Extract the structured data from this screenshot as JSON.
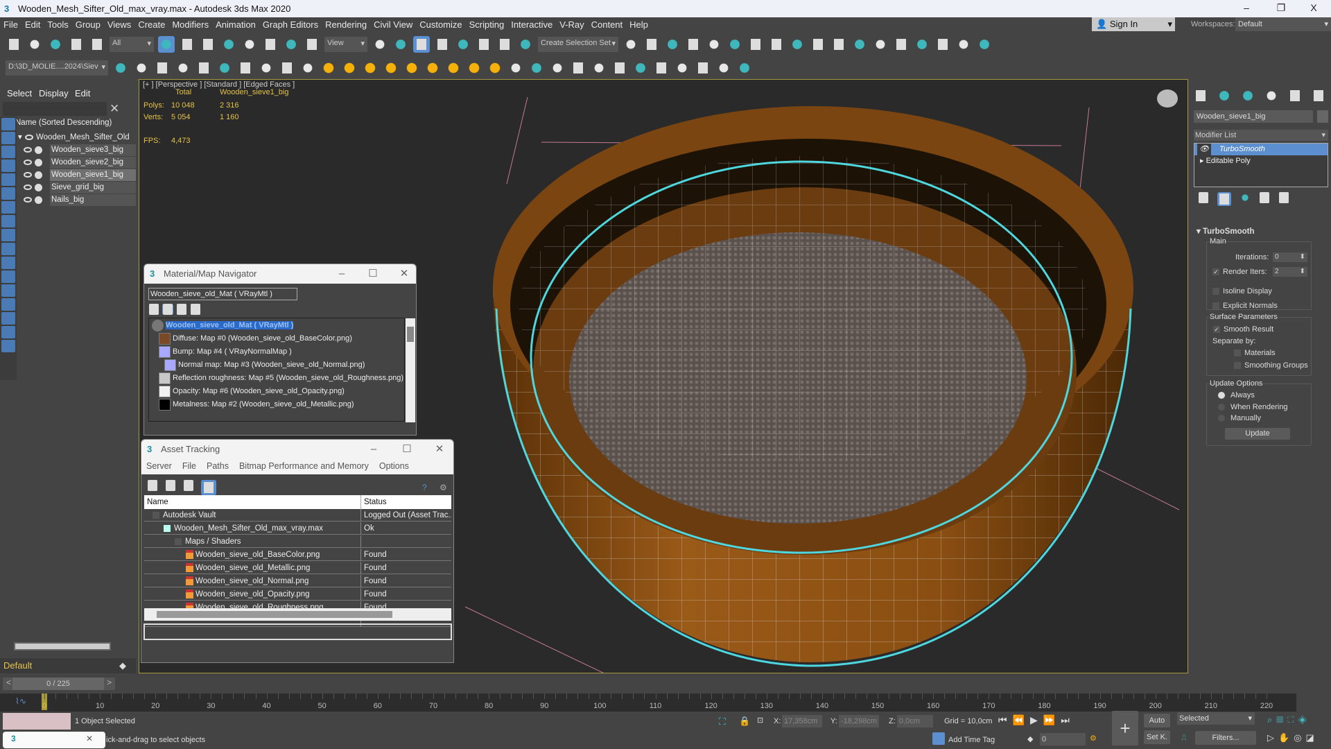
{
  "window": {
    "title": "Wooden_Mesh_Sifter_Old_max_vray.max - Autodesk 3ds Max 2020",
    "minimize": "–",
    "restore": "❐",
    "close": "X"
  },
  "menu": [
    "File",
    "Edit",
    "Tools",
    "Group",
    "Views",
    "Create",
    "Modifiers",
    "Animation",
    "Graph Editors",
    "Rendering",
    "Civil View",
    "Customize",
    "Scripting",
    "Interactive",
    "V-Ray",
    "Content",
    "Help"
  ],
  "account": {
    "sign_in": "Sign In",
    "workspaces_label": "Workspaces:",
    "workspace": "Default"
  },
  "toolbar1": {
    "filter": "All",
    "ref_coord": "View",
    "selection_set": "Create Selection Set",
    "icons": [
      "undo-icon",
      "redo-icon",
      "link-icon",
      "unlink-icon",
      "bind-spacewarp-icon",
      "select-object-icon",
      "select-by-name-icon",
      "rect-selection-icon",
      "window-crossing-icon",
      "move-icon",
      "rotate-icon",
      "scale-icon",
      "placement-icon",
      "pivot-icon",
      "keyboard-shortcut-icon",
      "select-manipulate-icon",
      "snap-3d-icon",
      "angle-snap-icon",
      "percent-snap-icon",
      "spinner-snap-icon",
      "edit-named-sets-icon",
      "mirror-icon",
      "align-icon",
      "scene-explorer-icon",
      "layer-explorer-icon",
      "toggle-ribbon-icon",
      "curve-editor-icon",
      "dope-sheet-icon",
      "schematic-view-icon",
      "material-editor-icon",
      "render-setup-icon",
      "rendered-frame-icon",
      "render-icon",
      "render-iterative-icon",
      "render-online-icon",
      "vray-icon",
      "a360-icon",
      "render-in-cloud-icon",
      "render-queue-icon"
    ]
  },
  "toolbar2": {
    "project_path": "D:\\3D_MOLIE....2024\\Siev",
    "icons": [
      "project-settings-icon",
      "open-project-icon",
      "new-project-icon",
      "project-folder-icon",
      "teapot-icon",
      "sphere-object-icon",
      "box-object-icon",
      "vray-light-icon",
      "vray-camera-icon",
      "physical-camera-icon",
      "dome-light-icon",
      "sphere-light-icon",
      "sun-icon",
      "mesh-light-icon",
      "ies-light-icon",
      "spot-light-icon",
      "sun-sky-icon",
      "ambient-light-icon",
      "proxy-icon",
      "vray-fur-icon",
      "vray-plane-icon",
      "fire-icon",
      "vray-mtl-icon",
      "multi-material-icon",
      "material-palette-icon",
      "material-convert-icon",
      "frame-buffer-icon",
      "vray-logo-icon",
      "forest-icon",
      "log-icon",
      "help-icon"
    ]
  },
  "explorer": {
    "menu": [
      "Select",
      "Display",
      "Edit"
    ],
    "column": "Name (Sorted Descending)",
    "items": [
      {
        "name": "Wooden_Mesh_Sifter_Old",
        "level": 0
      },
      {
        "name": "Wooden_sieve3_big",
        "level": 1
      },
      {
        "name": "Wooden_sieve2_big",
        "level": 1
      },
      {
        "name": "Wooden_sieve1_big",
        "level": 1,
        "selected": true
      },
      {
        "name": "Sieve_grid_big",
        "level": 1
      },
      {
        "name": "Nails_big",
        "level": 1
      }
    ],
    "layer": "Default"
  },
  "viewport": {
    "label": "[+ ] [Perspective ] [Standard ] [Edged Faces ]",
    "stats": {
      "col_total": "Total",
      "col_sel": "Wooden_sieve1_big",
      "polys_label": "Polys:",
      "polys_total": "10 048",
      "polys_sel": "2 316",
      "verts_label": "Verts:",
      "verts_total": "5 054",
      "verts_sel": "1 160",
      "fps_label": "FPS:",
      "fps": "4,473"
    },
    "colors": {
      "wood": "#8a4e12",
      "selection": "#4fd7e0",
      "border": "#a89a3c"
    }
  },
  "material_navigator": {
    "title": "Material/Map Navigator",
    "field": "Wooden_sieve_old_Mat  ( VRayMtl )",
    "root": "Wooden_sieve_old_Mat  ( VRayMtl )",
    "maps": [
      {
        "label": "Diffuse: Map #0 (Wooden_sieve_old_BaseColor.png)",
        "swatch": "#7a4a26",
        "indent": 0
      },
      {
        "label": "Bump: Map #4  ( VRayNormalMap )",
        "swatch": "#a9a8ff",
        "indent": 0
      },
      {
        "label": "Normal map: Map #3 (Wooden_sieve_old_Normal.png)",
        "swatch": "#a9a8ff",
        "indent": 1
      },
      {
        "label": "Reflection roughness: Map #5 (Wooden_sieve_old_Roughness.png)",
        "swatch": "#c8c8c8",
        "indent": 0
      },
      {
        "label": "Opacity: Map #6 (Wooden_sieve_old_Opacity.png)",
        "swatch": "#f0f0f0",
        "indent": 0
      },
      {
        "label": "Metalness: Map #2 (Wooden_sieve_old_Metallic.png)",
        "swatch": "#000000",
        "indent": 0
      }
    ]
  },
  "asset_tracking": {
    "title": "Asset Tracking",
    "menu": [
      "Server",
      "File",
      "Paths",
      "Bitmap Performance and Memory",
      "Options"
    ],
    "columns": [
      "Name",
      "Status"
    ],
    "rows": [
      {
        "name": "Autodesk Vault",
        "status": "Logged Out (Asset Trac...",
        "indent": 0,
        "icon": "vault-icon"
      },
      {
        "name": "Wooden_Mesh_Sifter_Old_max_vray.max",
        "status": "Ok",
        "indent": 1,
        "icon": "max-file-icon"
      },
      {
        "name": "Maps / Shaders",
        "status": "",
        "indent": 2,
        "icon": "maps-folder-icon"
      },
      {
        "name": "Wooden_sieve_old_BaseColor.png",
        "status": "Found",
        "indent": 3,
        "icon": "png-file-icon"
      },
      {
        "name": "Wooden_sieve_old_Metallic.png",
        "status": "Found",
        "indent": 3,
        "icon": "png-file-icon"
      },
      {
        "name": "Wooden_sieve_old_Normal.png",
        "status": "Found",
        "indent": 3,
        "icon": "png-file-icon"
      },
      {
        "name": "Wooden_sieve_old_Opacity.png",
        "status": "Found",
        "indent": 3,
        "icon": "png-file-icon"
      },
      {
        "name": "Wooden_sieve_old_Roughness.png",
        "status": "Found",
        "indent": 3,
        "icon": "png-file-icon"
      }
    ]
  },
  "command_panel": {
    "object_name": "Wooden_sieve1_big",
    "modifier_list": "Modifier List",
    "stack": [
      "TurboSmooth",
      "Editable Poly"
    ],
    "rollout": "TurboSmooth",
    "main": "Main",
    "iterations_label": "Iterations:",
    "iterations": "0",
    "render_iters_label": "Render Iters:",
    "render_iters": "2",
    "isoline": "Isoline Display",
    "explicit_normals": "Explicit Normals",
    "surface": "Surface Parameters",
    "smooth_result": "Smooth Result",
    "separate_by": "Separate by:",
    "materials": "Materials",
    "smoothing_groups": "Smoothing Groups",
    "update_options": "Update Options",
    "always": "Always",
    "when_rendering": "When Rendering",
    "manually": "Manually",
    "update": "Update"
  },
  "timeline": {
    "frame": "0 / 225",
    "ticks": [
      0,
      10,
      20,
      30,
      40,
      50,
      60,
      70,
      80,
      90,
      100,
      110,
      120,
      130,
      140,
      150,
      160,
      170,
      180,
      190,
      200,
      210,
      220
    ],
    "current": 0,
    "end": 225
  },
  "status": {
    "selected": "1 Object Selected",
    "prompt": "ick-and-drag to select objects",
    "x_label": "X:",
    "x": "17,358cm",
    "y_label": "Y:",
    "y": "-18,298cm",
    "z_label": "Z:",
    "z": "0,0cm",
    "grid": "Grid = 10,0cm",
    "add_time_tag": "Add Time Tag",
    "frame_field": "0",
    "auto": "Auto",
    "set_key": "Set K.",
    "key_filter": "Selected",
    "filters": "Filters..."
  }
}
